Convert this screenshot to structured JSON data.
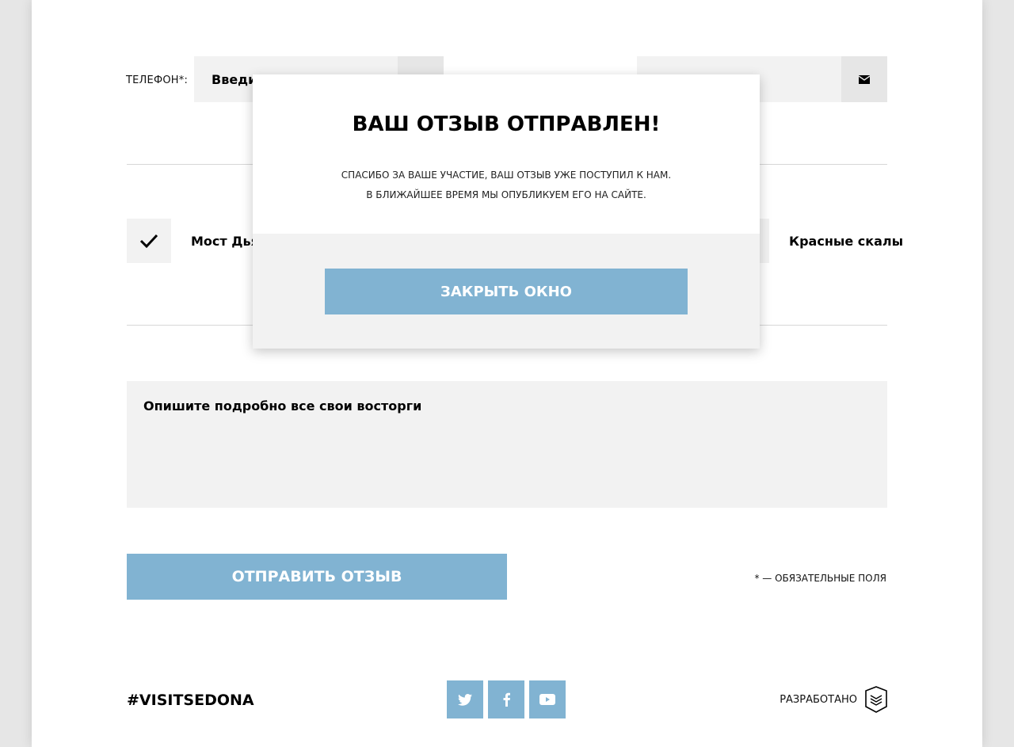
{
  "form": {
    "phone_label": "Телефон*:",
    "phone_value": "Введит",
    "sights": {
      "left_label": "Мост Дьяв",
      "right_label": "Красные скалы"
    },
    "textarea_placeholder": "Опишите подробно все свои восторги",
    "submit_label": "Отправить отзыв",
    "required_note": "* — обязательные поля"
  },
  "footer": {
    "hashtag": "#VISITSEDONA",
    "socials": [
      "twitter-icon",
      "facebook-icon",
      "youtube-icon"
    ],
    "developed_label": "Разработано"
  },
  "modal": {
    "title": "Ваш отзыв отправлен!",
    "line1": "Спасибо за ваше участие, ваш отзыв уже поступил к нам.",
    "line2": "В ближайшее время мы опубликуем его на сайте.",
    "close_label": "Закрыть окно"
  },
  "colors": {
    "accent": "#81b3d2",
    "field_bg": "#f2f2f2",
    "page_bg": "#e6e6e6"
  }
}
